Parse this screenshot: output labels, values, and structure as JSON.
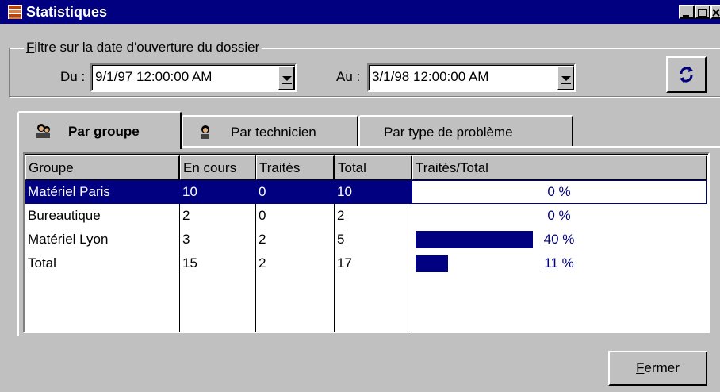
{
  "window": {
    "title": "Statistiques"
  },
  "filter": {
    "legend": "Filtre sur la date d'ouverture du dossier",
    "du_label": "Du :",
    "du_value": "9/1/97 12:00:00 AM",
    "au_label": "Au :",
    "au_value": "3/1/98 12:00:00 AM"
  },
  "tabs": [
    {
      "label": "Par groupe",
      "icon": "person-group-icon",
      "active": true
    },
    {
      "label": "Par technicien",
      "icon": "technician-icon",
      "active": false
    },
    {
      "label": "Par type de problème",
      "icon": "",
      "active": false
    }
  ],
  "table": {
    "columns": [
      "Groupe",
      "En cours",
      "Traités",
      "Total",
      "Traités/Total"
    ],
    "rows": [
      {
        "groupe": "Matériel Paris",
        "en_cours": "10",
        "traites": "0",
        "total": "10",
        "ratio": "0 %",
        "ratio_value": 0,
        "selected": true
      },
      {
        "groupe": "Bureautique",
        "en_cours": "2",
        "traites": "0",
        "total": "2",
        "ratio": "0 %",
        "ratio_value": 0,
        "selected": false
      },
      {
        "groupe": "Matériel Lyon",
        "en_cours": "3",
        "traites": "2",
        "total": "5",
        "ratio": "40 %",
        "ratio_value": 40,
        "selected": false
      },
      {
        "groupe": "Total",
        "en_cours": "15",
        "traites": "2",
        "total": "17",
        "ratio": "11 %",
        "ratio_value": 11,
        "selected": false
      }
    ]
  },
  "buttons": {
    "close": "Fermer"
  },
  "colors": {
    "selection": "#000080",
    "face": "#c0c0c0",
    "title": "#000080"
  }
}
